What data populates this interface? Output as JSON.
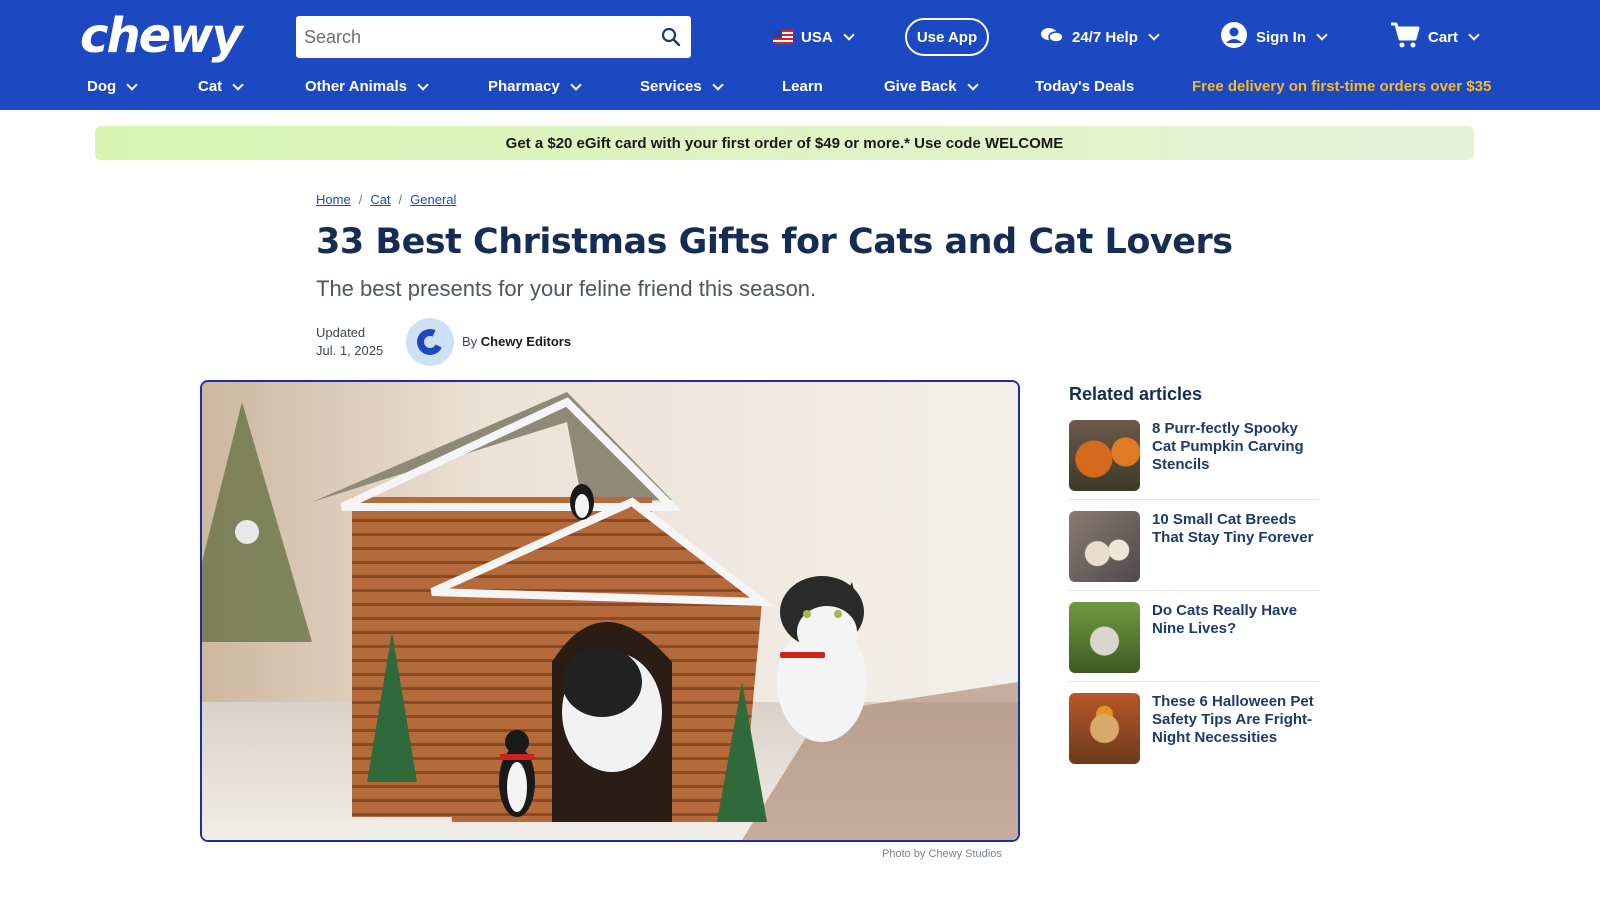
{
  "header": {
    "logo_text": "chewy",
    "search_placeholder": "Search",
    "country": "USA",
    "use_app": "Use App",
    "help": "24/7 Help",
    "sign_in": "Sign In",
    "cart": "Cart"
  },
  "nav": {
    "items": [
      "Dog",
      "Cat",
      "Other Animals",
      "Pharmacy",
      "Services",
      "Learn",
      "Give Back",
      "Today's Deals"
    ],
    "promo": "Free delivery on first-time orders over $35"
  },
  "promo_banner": "Get a $20 eGift card with your first order of $49 or more.* Use code WELCOME",
  "breadcrumb": {
    "items": [
      "Home",
      "Cat",
      "General"
    ],
    "separator": "/"
  },
  "article": {
    "title": "33 Best Christmas Gifts for Cats and Cat Lovers",
    "subtitle": "The best presents for your feline friend this season.",
    "updated_label": "Updated",
    "updated_date": "Jul. 1, 2025",
    "by": "By",
    "author": "Chewy Editors",
    "photo_caption": "Photo by Chewy Studios"
  },
  "related": {
    "title": "Related articles",
    "items": [
      {
        "title": "8 Purr-fectly Spooky Cat Pumpkin Carving Stencils",
        "thumb_color": "#b5642a"
      },
      {
        "title": "10 Small Cat Breeds That Stay Tiny Forever",
        "thumb_color": "#7a6d68"
      },
      {
        "title": "Do Cats Really Have Nine Lives?",
        "thumb_color": "#5a7a3a"
      },
      {
        "title": "These 6 Halloween Pet Safety Tips Are Fright-Night Necessities",
        "thumb_color": "#b8572a"
      }
    ]
  },
  "colors": {
    "brand_blue": "#1c49c2",
    "promo_yellow": "#f5b930",
    "title_navy": "#162c55"
  }
}
